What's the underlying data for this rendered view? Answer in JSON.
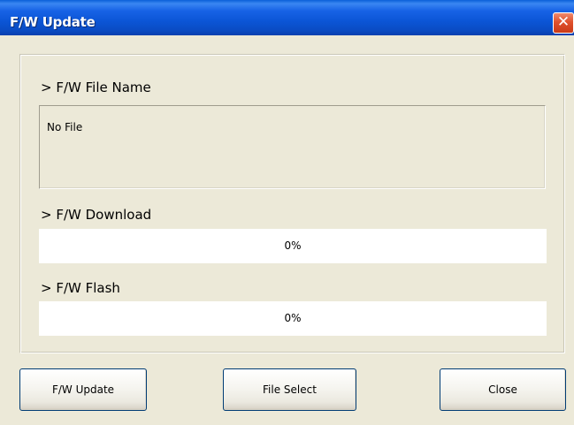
{
  "window": {
    "title": "F/W Update",
    "close_glyph": "✕",
    "close_icon": "close-icon"
  },
  "file_section": {
    "label": "> F/W File Name",
    "value": "No File"
  },
  "download_section": {
    "label": "> F/W Download",
    "progress_percent": 0,
    "progress_text": "0%"
  },
  "flash_section": {
    "label": "> F/W Flash",
    "progress_percent": 0,
    "progress_text": "0%"
  },
  "buttons": {
    "update_label": "F/W Update",
    "file_select_label": "File Select",
    "close_label": "Close"
  },
  "colors": {
    "titlebar": "#0a4cc4",
    "window_bg": "#ece9d8",
    "close_button": "#e0512c",
    "progress_fill": "#316ac5"
  }
}
